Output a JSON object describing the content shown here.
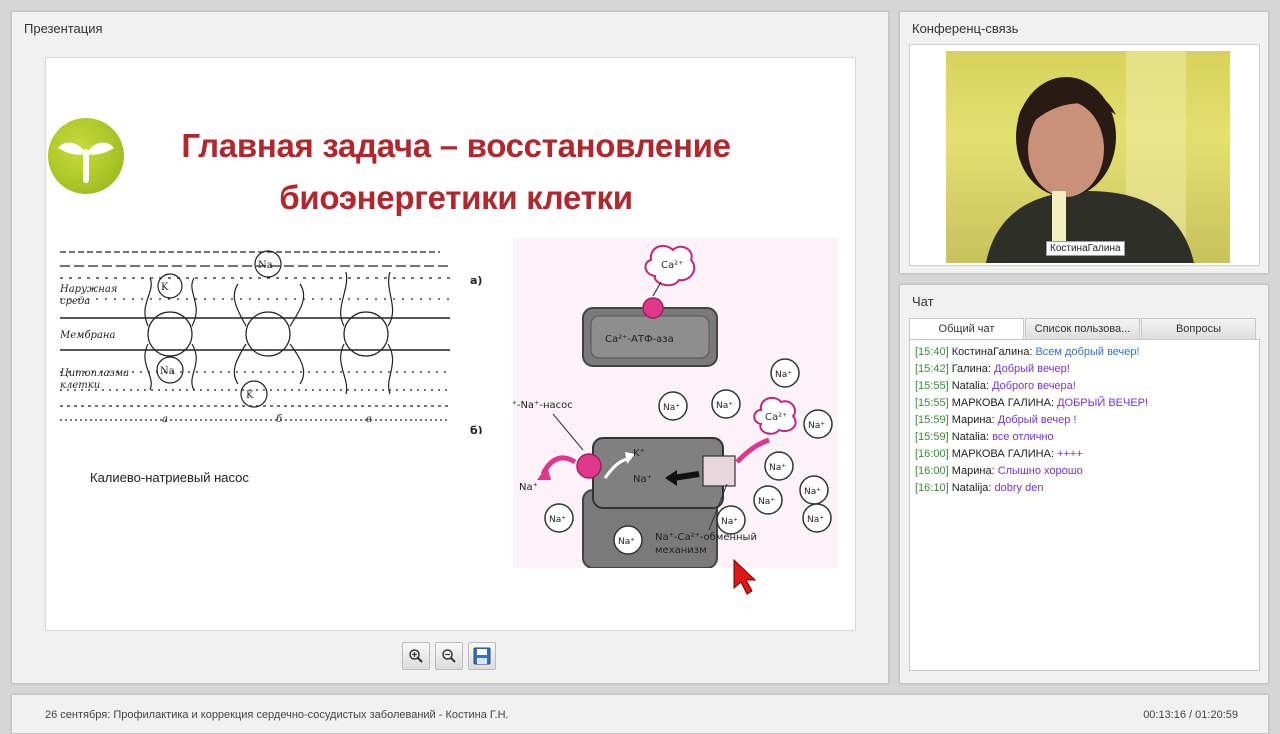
{
  "presentation": {
    "panel_title": "Презентация",
    "slide": {
      "title_line1": "Главная задача – восстановление",
      "title_line2": "биоэнергетики клетки",
      "caption": "Калиево-натриевый насос",
      "fig_left": {
        "label_a": "а)",
        "label_b": "б)",
        "side_outer": "Наружная среда",
        "side_membrane": "Мембрана",
        "side_cyto": "Цитоплазма клетки",
        "ion_na": "Na",
        "ion_k": "K",
        "letter_a": "а",
        "letter_b": "б",
        "letter_v": "в"
      },
      "fig_right": {
        "ca_ion": "Ca²⁺",
        "atpase": "Ca²⁺-АТФ-аза",
        "pump_label": "K⁺-Na⁺-насос",
        "k_ion": "K⁺",
        "na_ion": "Na⁺",
        "exchange_label_1": "Na⁺-Ca²⁺-обменный",
        "exchange_label_2": "механизм"
      }
    },
    "toolbar": {
      "zoom_in_icon": "zoom-in-icon",
      "zoom_out_icon": "zoom-out-icon",
      "save_icon": "save-icon"
    }
  },
  "conference": {
    "panel_title": "Конференц-связь",
    "video_name": "КостинаГалина"
  },
  "chat": {
    "panel_title": "Чат",
    "tabs": [
      "Общий чат",
      "Список пользова...",
      "Вопросы"
    ],
    "messages": [
      {
        "time": "[15:40]",
        "user": "КостинаГалина:",
        "text": "Всем добрый вечер!"
      },
      {
        "time": "[15:42]",
        "user": "Галина:",
        "text": "Добрый вечер!"
      },
      {
        "time": "[15:55]",
        "user": "Natalia:",
        "text": "Доброго вечера!"
      },
      {
        "time": "[15:55]",
        "user": "МАРКОВА ГАЛИНА:",
        "text": "ДОБРЫЙ ВЕЧЕР!"
      },
      {
        "time": "[15:59]",
        "user": "Марина:",
        "text": "Добрый вечер !"
      },
      {
        "time": "[15:59]",
        "user": "Natalia:",
        "text": "все отлично"
      },
      {
        "time": "[16:00]",
        "user": "МАРКОВА ГАЛИНА:",
        "text": "++++"
      },
      {
        "time": "[16:00]",
        "user": "Марина:",
        "text": "Слышно хорошо"
      },
      {
        "time": "[16:10]",
        "user": "Natalija:",
        "text": "dobry den"
      }
    ]
  },
  "bottom": {
    "title": "26 сентября: Профилактика и коррекция сердечно-сосудистых заболеваний - Костина Г.Н.",
    "time": "00:13:16 / 01:20:59"
  },
  "colors": {
    "title_red": "#b0282d",
    "logo_green": "#a8c428",
    "chat_time": "#3b8a3b",
    "chat_text": "#7a35c8"
  }
}
